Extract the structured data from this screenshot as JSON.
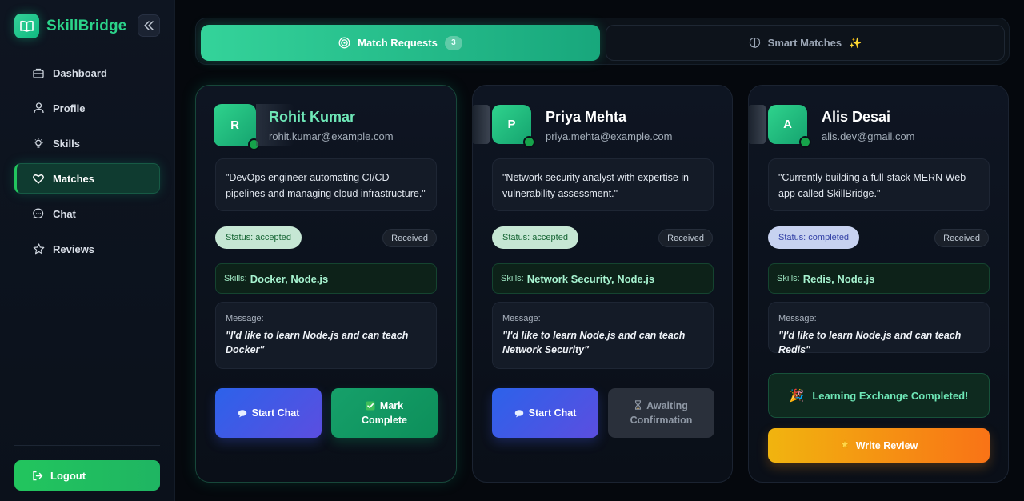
{
  "app": {
    "name": "SkillBridge"
  },
  "sidebar": {
    "items": [
      {
        "label": "Dashboard",
        "icon": "dashboard-icon"
      },
      {
        "label": "Profile",
        "icon": "user-icon"
      },
      {
        "label": "Skills",
        "icon": "lightbulb-icon"
      },
      {
        "label": "Matches",
        "icon": "heart-icon",
        "active": true
      },
      {
        "label": "Chat",
        "icon": "chat-bubble-icon"
      },
      {
        "label": "Reviews",
        "icon": "star-icon"
      }
    ],
    "logout_label": "Logout"
  },
  "tabs": {
    "requests": {
      "label": "Match Requests",
      "count": "3"
    },
    "smart": {
      "label": "Smart Matches"
    }
  },
  "cards": [
    {
      "initial": "R",
      "name": "Rohit Kumar",
      "email": "rohit.kumar@example.com",
      "bio": "\"DevOps engineer automating CI/CD pipelines and managing cloud infrastructure.\"",
      "status": "Status: accepted",
      "direction": "Received",
      "skills_label": "Skills:",
      "skills": "Docker, Node.js",
      "message_label": "Message:",
      "message": "\"I'd like to learn Node.js and can teach Docker\"",
      "chat_label": "Start Chat",
      "action_label": "Mark Complete"
    },
    {
      "initial": "P",
      "name": "Priya Mehta",
      "email": "priya.mehta@example.com",
      "bio": "\"Network security analyst with expertise in vulnerability assessment.\"",
      "status": "Status: accepted",
      "direction": "Received",
      "skills_label": "Skills:",
      "skills": "Network Security, Node.js",
      "message_label": "Message:",
      "message": "\"I'd like to learn Node.js and can teach Network Security\"",
      "chat_label": "Start Chat",
      "action_label": "Awaiting Confirmation"
    },
    {
      "initial": "A",
      "name": "Alis Desai",
      "email": "alis.dev@gmail.com",
      "bio": "\"Currently building a full-stack MERN Web-app called SkillBridge.\"",
      "status": "Status: completed",
      "direction": "Received",
      "skills_label": "Skills:",
      "skills": "Redis, Node.js",
      "message_label": "Message:",
      "message": "\"I'd like to learn Node.js and can teach Redis\"",
      "completed_label": "Learning Exchange Completed!",
      "review_label": "Write Review"
    }
  ],
  "colors": {
    "accent": "#22c55e",
    "brand": "#2bd38a",
    "chat_button": "#2c62ea",
    "review_button": "#f97316"
  }
}
